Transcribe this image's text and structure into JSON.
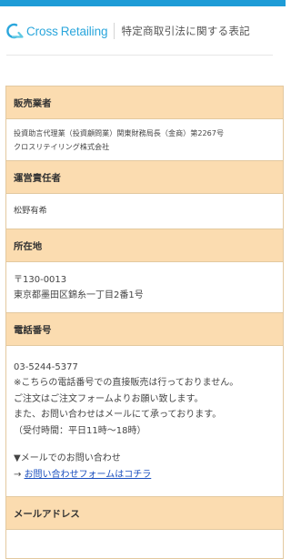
{
  "colors": {
    "accent": "#1e9cd7",
    "section_header_bg": "#fbdcb0",
    "border": "#e3c9a0",
    "link": "#1a4fbf"
  },
  "header": {
    "brand_word1": "Cross",
    "brand_word2": "Retailing",
    "page_title": "特定商取引法に関する表記",
    "logo_icon": "cross-retailing-logo-icon"
  },
  "sections": {
    "seller": {
      "heading": "販売業者",
      "lines": [
        "投資助言代理業（投資顧問業）関東財務局長（金商）第2267号",
        "クロスリテイリング株式会社"
      ]
    },
    "manager": {
      "heading": "運営責任者",
      "lines": [
        "松野有希"
      ]
    },
    "address": {
      "heading": "所在地",
      "lines": [
        "〒130-0013",
        "東京都墨田区錦糸一丁目2番1号"
      ]
    },
    "phone": {
      "heading": "電話番号",
      "lines": [
        "03-5244-5377",
        "※こちらの電話番号での直接販売は行っておりません。",
        "ご注文はご注文フォームよりお願い致します。",
        "また、お問い合わせはメールにて承っております。",
        "（受付時間：平日11時〜18時）"
      ],
      "mail_note": "▼メールでのお問い合わせ",
      "arrow": "→ ",
      "contact_link": "お問い合わせフォームはコチラ"
    },
    "email": {
      "heading": "メールアドレス"
    }
  }
}
